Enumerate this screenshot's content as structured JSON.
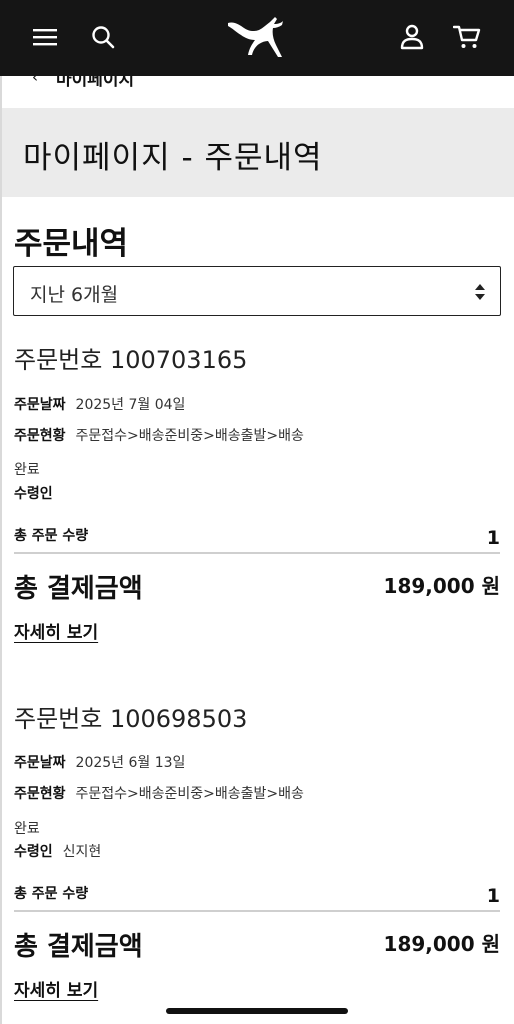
{
  "header": {
    "icons": [
      "menu-icon",
      "search-icon",
      "puma-logo",
      "user-icon",
      "cart-icon"
    ],
    "background": "#151515"
  },
  "breadcrumb": {
    "chevron": "‹",
    "label": "마이페이지"
  },
  "page_title": "마이페이지 - 주문내역",
  "section_title": "주문내역",
  "period_select": {
    "value": "지난 6개월"
  },
  "orders": [
    {
      "number": "주문번호 100703165",
      "date_label": "주문날짜",
      "date_value": "2025년 7월 04일",
      "status_label": "주문현황",
      "status_value": "주문접수>배송준비중>배송출발>배송",
      "status_tail": "완료",
      "recipient_label": "수령인",
      "recipient_value": "",
      "qty_label": "총 주문 수량",
      "qty_value": "1",
      "total_label": "총 결제금액",
      "total_value": "189,000 원",
      "detail_link": "자세히 보기"
    },
    {
      "number": "주문번호 100698503",
      "date_label": "주문날짜",
      "date_value": "2025년 6월 13일",
      "status_label": "주문현황",
      "status_value": "주문접수>배송준비중>배송출발>배송",
      "status_tail": "완료",
      "recipient_label": "수령인",
      "recipient_value": "신지현",
      "qty_label": "총 주문 수량",
      "qty_value": "1",
      "total_label": "총 결제금액",
      "total_value": "189,000 원",
      "detail_link": "자세히 보기"
    }
  ]
}
